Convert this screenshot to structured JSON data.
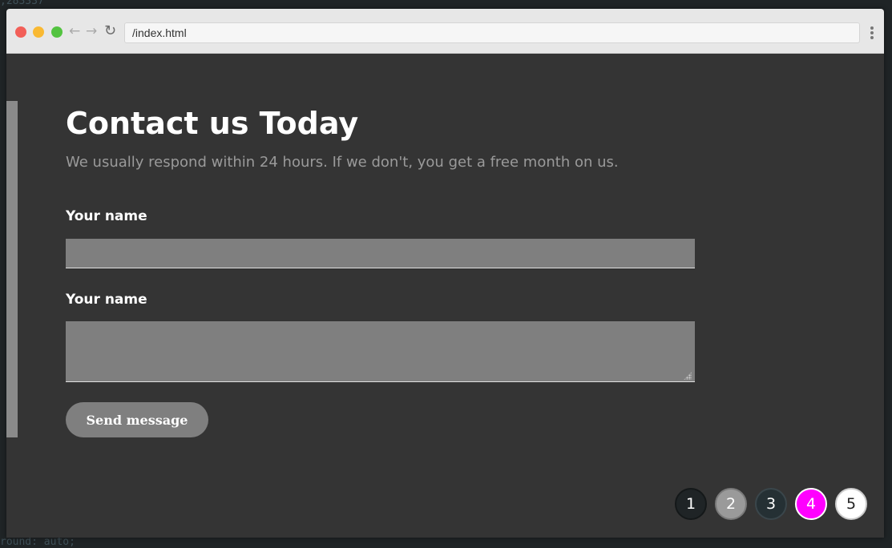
{
  "browser": {
    "url": "/index.html"
  },
  "page": {
    "title": "Contact us Today",
    "subtitle": "We usually respond within 24 hours. If we don't, you get a free month on us.",
    "form": {
      "name_label": "Your name",
      "name_value": "",
      "message_label": "Your name",
      "message_value": "",
      "submit_label": "Send message"
    }
  },
  "pagination": {
    "pages": [
      "1",
      "2",
      "3",
      "4",
      "5"
    ],
    "active": "4"
  },
  "background_code": {
    "top_fragment": ";283337",
    "bottom_fragment": "round: auto;"
  },
  "colors": {
    "page_bg": "#343434",
    "field_bg": "#7f7f7f",
    "accent_active_page": "#ff00ff"
  }
}
